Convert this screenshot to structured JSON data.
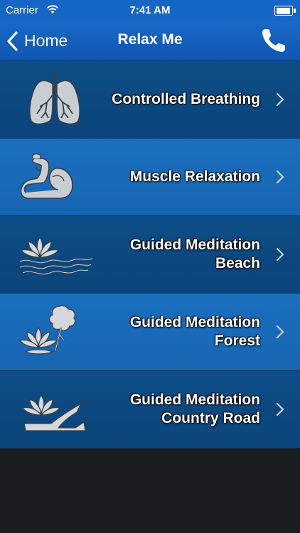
{
  "status": {
    "carrier": "Carrier",
    "time": "7:41 AM"
  },
  "nav": {
    "back_label": "Home",
    "title": "Relax Me"
  },
  "rows": [
    {
      "lines": [
        "Controlled Breathing"
      ],
      "icon": "lungs-icon"
    },
    {
      "lines": [
        "Muscle Relaxation"
      ],
      "icon": "flexed-arm-icon"
    },
    {
      "lines": [
        "Guided Meditation",
        "Beach"
      ],
      "icon": "lotus-waves-icon"
    },
    {
      "lines": [
        "Guided Meditation",
        "Forest"
      ],
      "icon": "lotus-tree-icon"
    },
    {
      "lines": [
        "Guided Meditation",
        "Country Road"
      ],
      "icon": "lotus-road-icon"
    }
  ],
  "colors": {
    "navbar": "#1666c6",
    "row_dark": "#0d4d86",
    "row_light": "#1a6fbf",
    "background": "#1b1d20"
  }
}
